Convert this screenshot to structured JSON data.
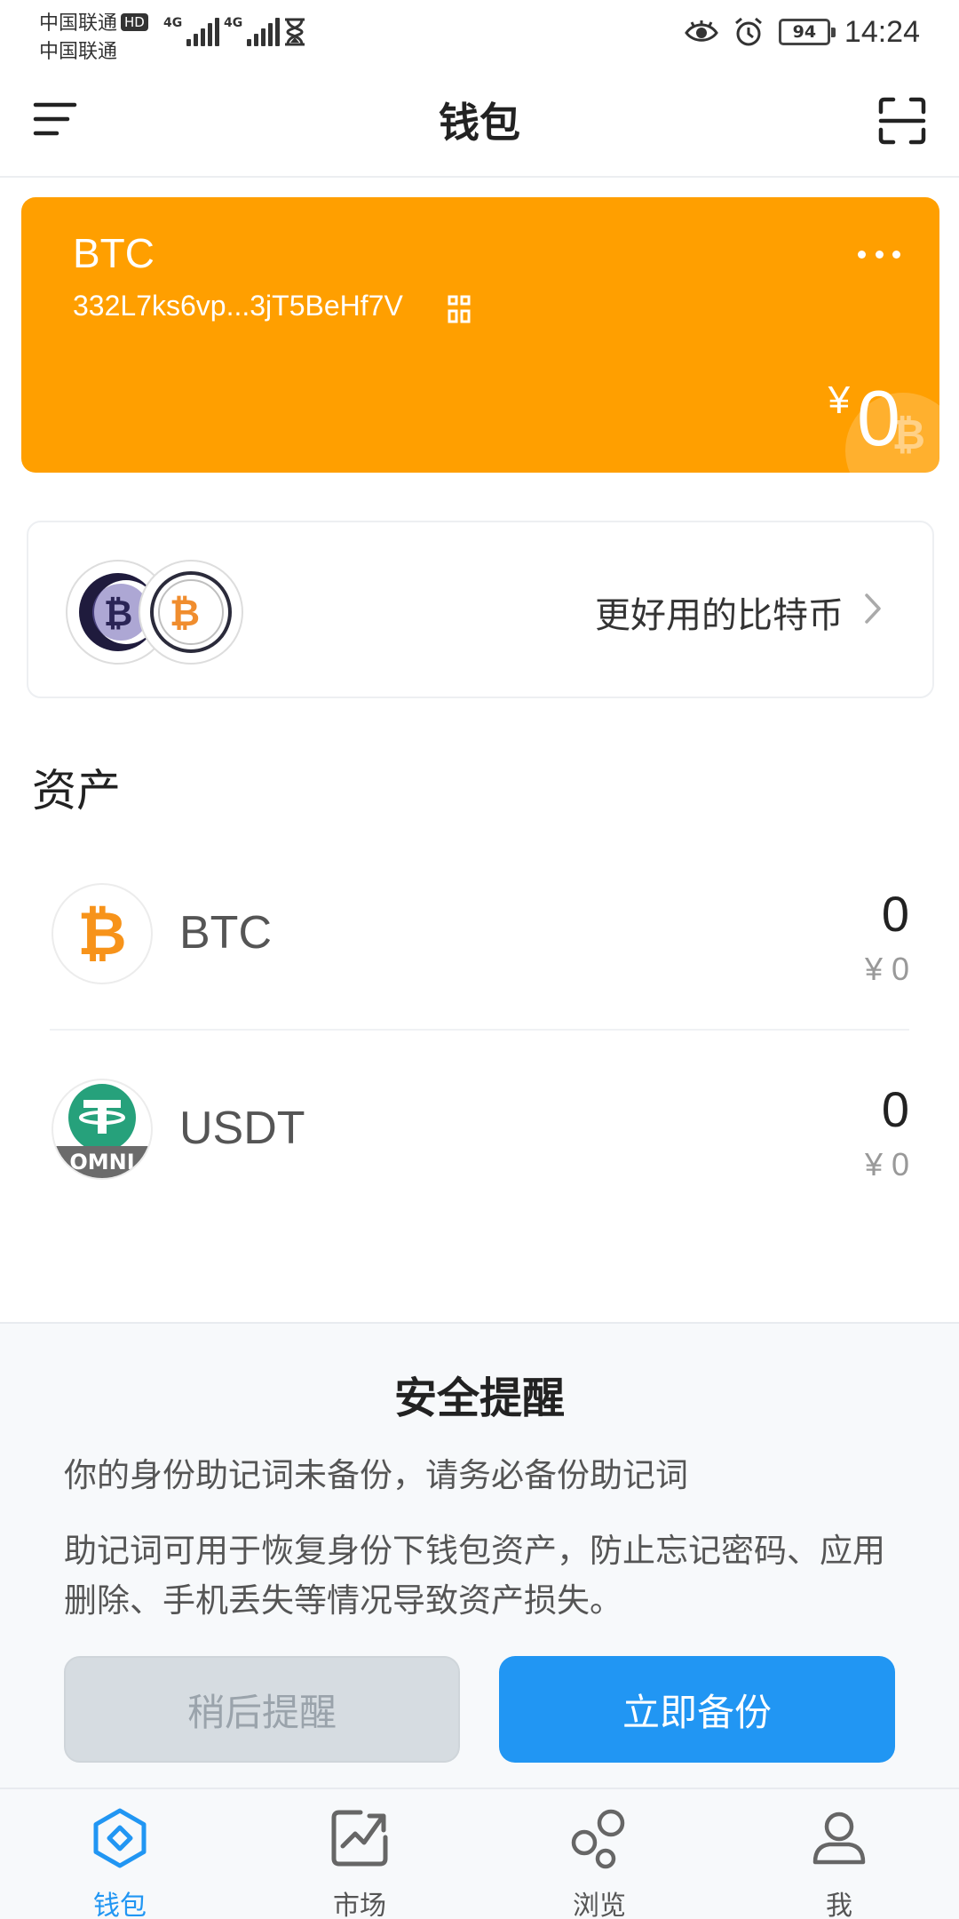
{
  "status_bar": {
    "carrier_1": "中国联通",
    "hd_badge": "HD",
    "carrier_2": "中国联通",
    "network_type_1": "4G",
    "network_type_2": "4G",
    "battery": "94",
    "time": "14:24"
  },
  "header": {
    "title": "钱包",
    "menu_icon": "menu-icon",
    "scan_icon": "scan-icon"
  },
  "wallet_card": {
    "name": "BTC",
    "address": "332L7ks6vp...3jT5BeHf7V",
    "currency_symbol": "¥",
    "balance": "0",
    "background_color": "#ff9f00"
  },
  "promo": {
    "text": "更好用的比特币"
  },
  "assets": {
    "heading": "资产",
    "items": [
      {
        "symbol": "BTC",
        "quantity": "0",
        "fiat": "¥ 0",
        "icon": "bitcoin-icon"
      },
      {
        "symbol": "USDT",
        "quantity": "0",
        "fiat": "¥ 0",
        "icon": "tether-omni-icon"
      }
    ]
  },
  "security_reminder": {
    "title": "安全提醒",
    "warning": "你的身份助记词未备份，请务必备份助记词",
    "description": "助记词可用于恢复身份下钱包资产，防止忘记密码、应用删除、手机丢失等情况导致资产损失。",
    "later_button": "稍后提醒",
    "backup_button": "立即备份"
  },
  "bottom_nav": {
    "items": [
      {
        "label": "钱包",
        "icon": "wallet-icon",
        "active": true
      },
      {
        "label": "市场",
        "icon": "market-icon",
        "active": false
      },
      {
        "label": "浏览",
        "icon": "browse-icon",
        "active": false
      },
      {
        "label": "我",
        "icon": "profile-icon",
        "active": false
      }
    ]
  },
  "colors": {
    "accent": "#2196f3",
    "card": "#ff9f00",
    "tether_green": "#26a17b",
    "bitcoin_orange": "#f7931a"
  }
}
